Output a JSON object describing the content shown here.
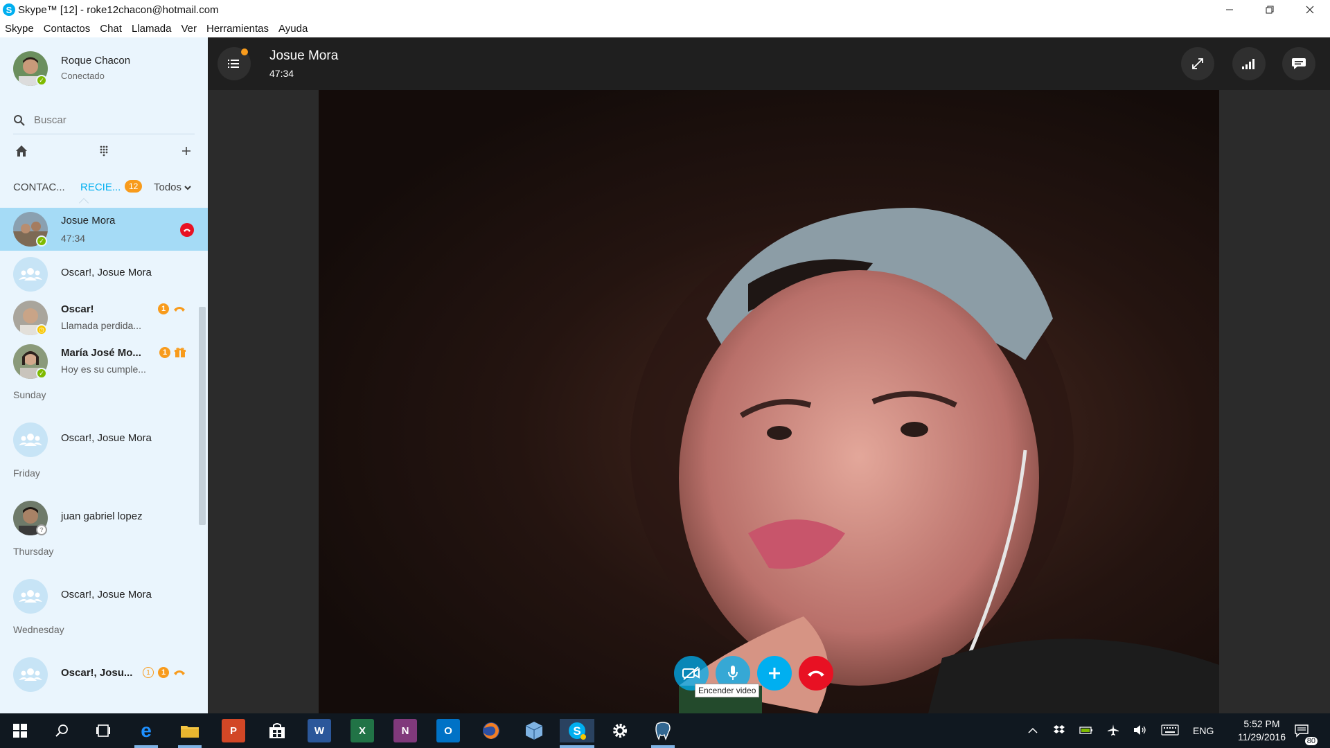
{
  "window": {
    "title": "Skype™ [12] - roke12chacon@hotmail.com",
    "logo_letter": "S"
  },
  "menu": [
    "Skype",
    "Contactos",
    "Chat",
    "Llamada",
    "Ver",
    "Herramientas",
    "Ayuda"
  ],
  "profile": {
    "name": "Roque Chacon",
    "mood": "Conectado"
  },
  "search": {
    "placeholder": "Buscar"
  },
  "tabs": {
    "contacts": "CONTAC...",
    "recent": "RECIE...",
    "recent_count": "12",
    "filter": "Todos"
  },
  "recents": [
    {
      "title": "Josue Mora",
      "sub": "47:34"
    },
    {
      "title": "Oscar!, Josue Mora"
    },
    {
      "title": "Oscar!",
      "sub": "Llamada perdida...",
      "badge": "1"
    },
    {
      "title": "María José Mo...",
      "sub": "Hoy es su cumple...",
      "badge": "1"
    },
    {
      "title": "Oscar!, Josue Mora"
    },
    {
      "title": "juan gabriel lopez"
    },
    {
      "title": "Oscar!, Josue Mora"
    },
    {
      "title": "Oscar!, Josu...",
      "badge_outline": "1",
      "badge": "1"
    }
  ],
  "sections": [
    "Sunday",
    "Friday",
    "Thursday",
    "Wednesday"
  ],
  "call": {
    "name": "Josue Mora",
    "timer": "47:34",
    "tooltip": "Encender video"
  },
  "taskbar": {
    "lang": "ENG",
    "time": "5:52 PM",
    "date": "11/29/2016",
    "notifications": "80"
  },
  "colors": {
    "skype_blue": "#00aff0",
    "sidebar_bg": "#eaf5fd",
    "selected_row": "#a5dbf6",
    "end_call_red": "#e81123",
    "badge_orange": "#f89b1c",
    "online_green": "#7fba00"
  }
}
